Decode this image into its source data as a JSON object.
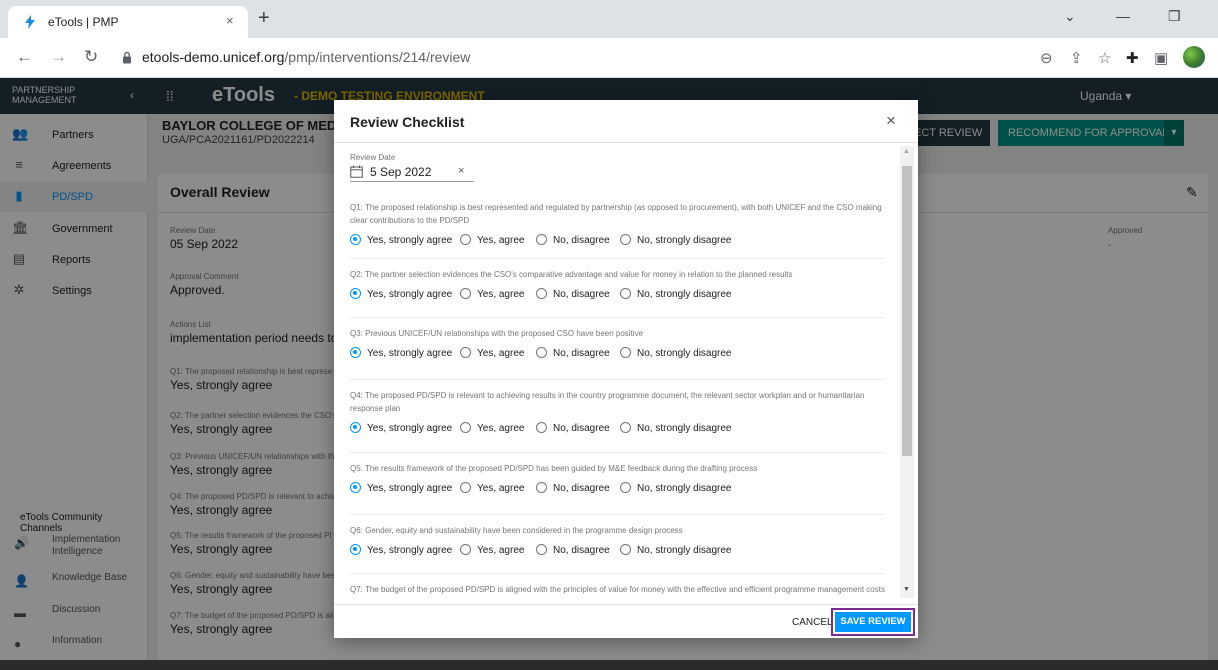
{
  "browser": {
    "tab_title": "eTools | PMP",
    "tab_close": "×",
    "new_tab": "+",
    "url_host": "etools-demo.unicef.org",
    "url_path": "/pmp/interventions/214/review"
  },
  "sidebar": {
    "header": "PARTNERSHIP MANAGEMENT",
    "items": [
      {
        "label": "Partners",
        "icon": "partners-icon"
      },
      {
        "label": "Agreements",
        "icon": "agreements-icon"
      },
      {
        "label": "PD/SPD",
        "icon": "document-icon"
      },
      {
        "label": "Government",
        "icon": "government-icon"
      },
      {
        "label": "Reports",
        "icon": "reports-icon"
      },
      {
        "label": "Settings",
        "icon": "gear-icon"
      }
    ],
    "channels_title": "eTools Community Channels",
    "channels": [
      {
        "label": "Implementation Intelligence"
      },
      {
        "label": "Knowledge Base"
      },
      {
        "label": "Discussion"
      },
      {
        "label": "Information"
      }
    ]
  },
  "topbar": {
    "logo": "eTools",
    "demo_label": "- DEMO TESTING ENVIRONMENT",
    "country": "Uganda ▾"
  },
  "page": {
    "partner_name": "BAYLOR COLLEGE OF MEDICINE",
    "reference": "UGA/PCA2021161/PD2022214",
    "reject_label": "ECT REVIEW",
    "recommend_label": "RECOMMEND FOR APPROVAL",
    "card_title": "Overall Review",
    "fields": [
      {
        "label": "Review Date",
        "value": "05 Sep 2022"
      },
      {
        "label": "Approval Comment",
        "value": "Approved."
      },
      {
        "label": "Actions List",
        "value": "implementation period needs to be"
      },
      {
        "label": "Q1: The proposed relationship is best represe",
        "value": "Yes, strongly agree"
      },
      {
        "label": "Q2: The partner selection evidences the CSO's",
        "value": "Yes, strongly agree"
      },
      {
        "label": "Q3: Previous UNICEF/UN relationships with th",
        "value": "Yes, strongly agree"
      },
      {
        "label": "Q4: The proposed PD/SPD is relevant to achie",
        "value": "Yes, strongly agree"
      },
      {
        "label": "Q5: The results framework of the proposed PI",
        "value": "Yes, strongly agree"
      },
      {
        "label": "Q6: Gender, equity and sustainability have bee",
        "value": "Yes, strongly agree"
      },
      {
        "label": "Q7: The budget of the proposed PD/SPD is ali",
        "value": "Yes, strongly agree"
      }
    ],
    "approved_label": "Approved",
    "approved_value": "-"
  },
  "modal": {
    "title": "Review Checklist",
    "close": "×",
    "review_date_label": "Review Date",
    "review_date_value": "5 Sep 2022",
    "clear": "×",
    "options": [
      "Yes, strongly agree",
      "Yes, agree",
      "No, disagree",
      "No, strongly disagree"
    ],
    "questions": [
      {
        "text": "Q1: The proposed relationship is best represented and regulated by partnership (as opposed to procurement), with both UNICEF and the CSO making clear contributions to the PD/SPD",
        "selected": 0
      },
      {
        "text": "Q2: The partner selection evidences the CSO's comparative advantage and value for money in relation to the planned results",
        "selected": 0
      },
      {
        "text": "Q3: Previous UNICEF/UN relationships with the proposed CSO have been positive",
        "selected": 0
      },
      {
        "text": "Q4: The proposed PD/SPD is relevant to achieving results in the country programme document, the relevant sector workplan and or humanitarian response plan",
        "selected": 0
      },
      {
        "text": "Q5: The results framework of the proposed PD/SPD has been guided by M&E feedback during the drafting process",
        "selected": 0
      },
      {
        "text": "Q6: Gender, equity and sustainability have been considered in the programme design process",
        "selected": 0
      },
      {
        "text": "Q7: The budget of the proposed PD/SPD is aligned with the principles of value for money with the effective and efficient programme management costs",
        "selected": -1
      }
    ],
    "cancel_label": "CANCEL",
    "save_label": "SAVE REVIEW"
  },
  "colors": {
    "accent": "#0099ff",
    "header_bg": "#233944",
    "recommend_bg": "#009688",
    "highlight_outline": "#7b2d8e"
  }
}
